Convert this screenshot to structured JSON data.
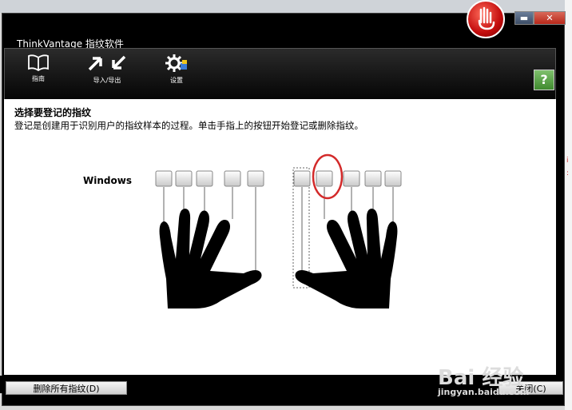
{
  "window": {
    "title": "ThinkVantage 指纹软件",
    "minimize": "▬",
    "close": "✕"
  },
  "toolbar": {
    "guide_label": "指南",
    "import_export_label": "导入/导出",
    "settings_label": "设置",
    "help_icon": "help-icon"
  },
  "content": {
    "heading": "选择要登记的指纹",
    "description": "登记是创建用于识别用户的指纹样本的过程。单击手指上的按钮开始登记或删除指纹。",
    "windows_label": "Windows"
  },
  "footer": {
    "delete_all_label": "删除所有指纹(D)",
    "close_label": "关闭(C)"
  },
  "watermark": {
    "brand": "Bai 经验",
    "url": "jingyan.baidu.com"
  },
  "colors": {
    "accent_red": "#d32a2a",
    "window_bg": "#000000",
    "content_bg": "#ffffff"
  }
}
